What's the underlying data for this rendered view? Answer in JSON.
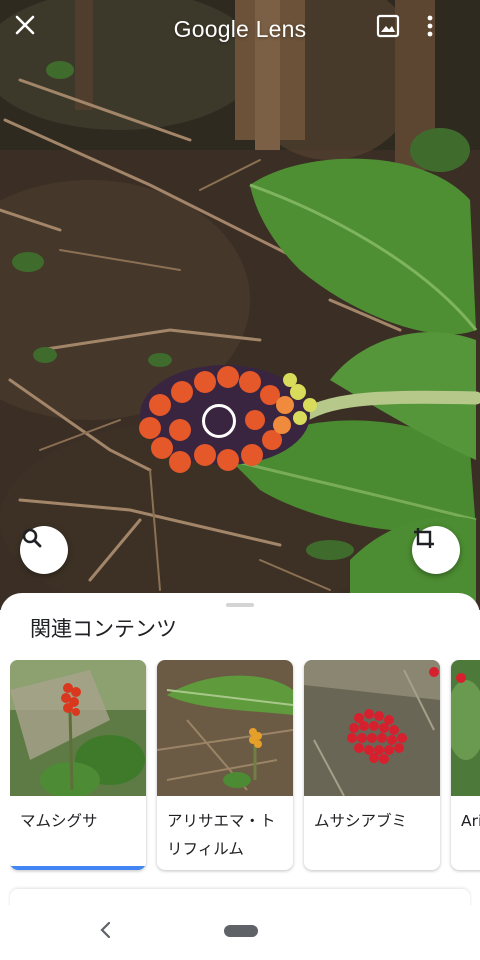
{
  "header": {
    "title": "Google Lens",
    "close_icon": "close-icon",
    "gallery_icon": "image-gallery-icon",
    "more_icon": "more-vert-icon"
  },
  "viewfinder": {
    "search_icon": "search-icon",
    "crop_icon": "crop-icon"
  },
  "sheet": {
    "title": "関連コンテンツ",
    "cards": [
      {
        "label": "マムシグサ",
        "selected": true
      },
      {
        "label": "アリサエマ・トリフィルム",
        "selected": false
      },
      {
        "label": "ムサシアブミ",
        "selected": false
      },
      {
        "label": "Ari eru",
        "selected": false
      }
    ]
  },
  "nav": {
    "back_icon": "back-icon",
    "home_icon": "home-pill-icon"
  },
  "colors": {
    "accent": "#4285f4",
    "text": "#202124"
  }
}
